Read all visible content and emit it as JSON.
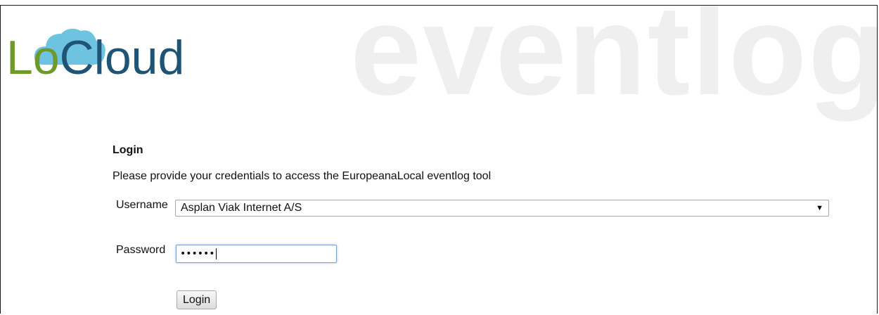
{
  "watermark": {
    "text": "eventlog"
  },
  "logo": {
    "part1": "Lo",
    "part2": "Cloud",
    "icon": "cloud-icon"
  },
  "login": {
    "title": "Login",
    "description": "Please provide your credentials to access the EuropeanaLocal eventlog tool",
    "username_label": "Username",
    "username_value": "Asplan Viak Internet A/S",
    "password_label": "Password",
    "password_masked": "••••••",
    "submit_label": "Login"
  },
  "colors": {
    "lo": "#6e9a2c",
    "cloud": "#1f5474",
    "cloud_icon": "#6ec3e0",
    "watermark": "#efefef"
  }
}
